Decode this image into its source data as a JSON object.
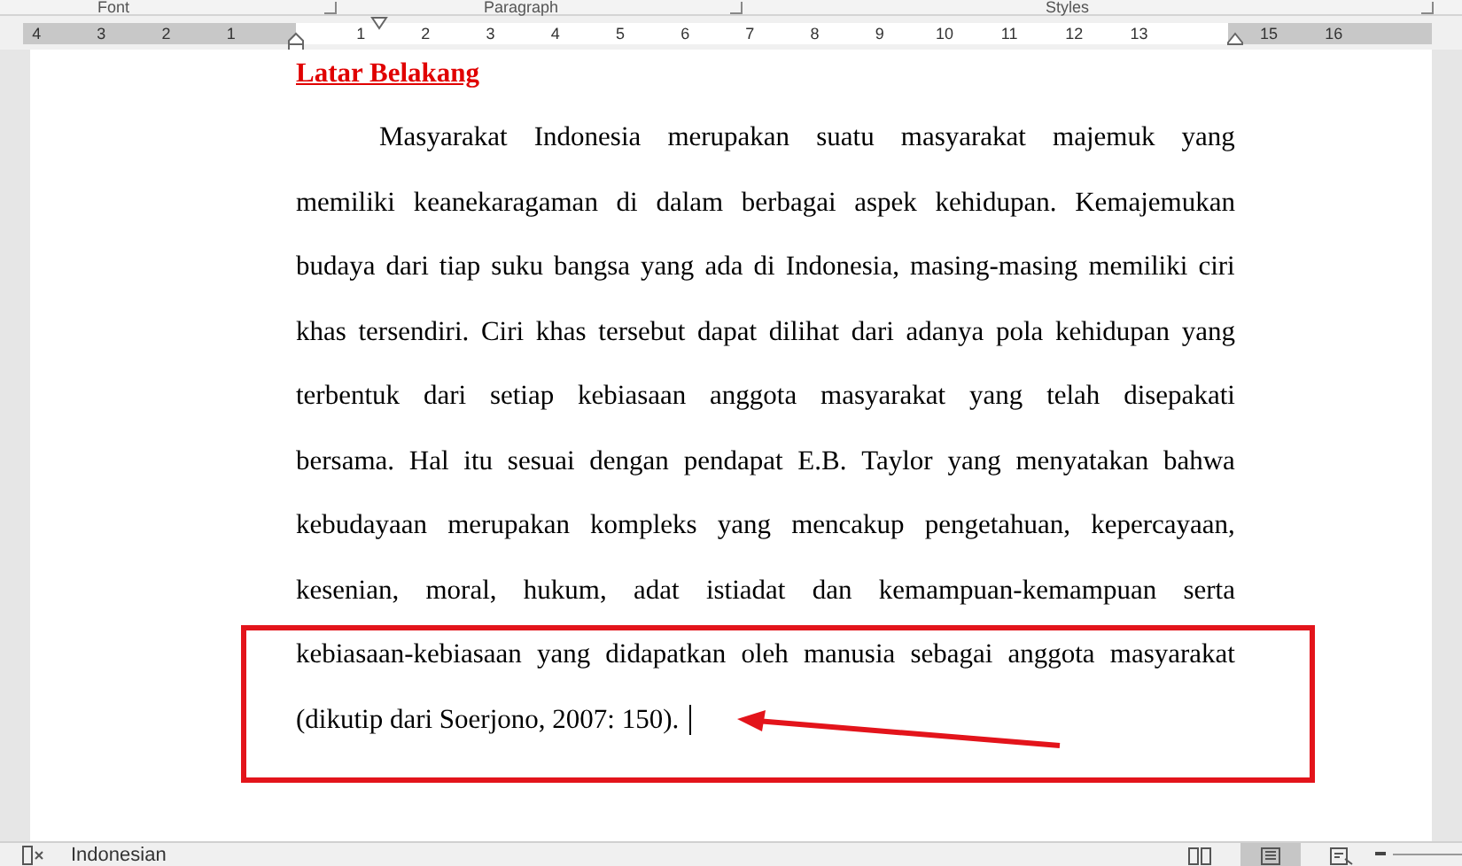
{
  "ribbon": {
    "groups": [
      "Font",
      "Paragraph",
      "Styles"
    ]
  },
  "ruler": {
    "left_numbers": [
      "4",
      "3",
      "2",
      "1"
    ],
    "right_numbers": [
      "1",
      "2",
      "3",
      "4",
      "5",
      "6",
      "7",
      "8",
      "9",
      "10",
      "11",
      "12",
      "13",
      "15",
      "16"
    ]
  },
  "document": {
    "heading": "Latar Belakang",
    "lines": [
      "Masyarakat Indonesia merupakan suatu masyarakat majemuk yang",
      "memiliki keanekaragaman di dalam berbagai aspek kehidupan. Kemajemukan",
      "budaya dari tiap suku bangsa yang ada di Indonesia, masing-masing memiliki ciri",
      "khas tersendiri. Ciri khas tersebut dapat dilihat dari adanya pola kehidupan yang",
      "terbentuk dari setiap kebiasaan anggota masyarakat yang telah disepakati",
      "bersama. Hal itu sesuai dengan pendapat E.B. Taylor yang menyatakan bahwa",
      "kebudayaan merupakan kompleks yang mencakup pengetahuan, kepercayaan,",
      "kesenian, moral, hukum, adat istiadat dan kemampuan-kemampuan serta",
      "kebiasaan-kebiasaan yang didapatkan oleh manusia sebagai anggota masyarakat",
      "(dikutip dari Soerjono, 2007: 150)."
    ]
  },
  "status_bar": {
    "language": "Indonesian",
    "views": [
      {
        "selected": false
      },
      {
        "selected": true
      },
      {
        "selected": false
      }
    ]
  }
}
